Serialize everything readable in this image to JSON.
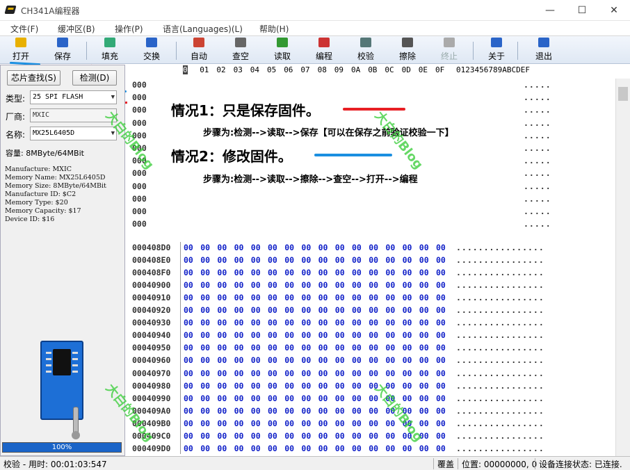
{
  "window": {
    "title": "CH341A编程器",
    "minimize": "—",
    "maximize": "☐",
    "close": "✕"
  },
  "menu": [
    "文件(F)",
    "缓冲区(B)",
    "操作(P)",
    "语言(Languages)(L)",
    "帮助(H)"
  ],
  "toolbar": [
    {
      "label": "打开",
      "icon": "folder-open-icon",
      "color": "#e8b000"
    },
    {
      "label": "保存",
      "icon": "save-disk-icon",
      "color": "#2a64c8"
    },
    {
      "label": "填充",
      "icon": "fill-icon",
      "color": "#3a7"
    },
    {
      "label": "交换",
      "icon": "swap-arrows-icon",
      "color": "#2a64c8"
    },
    {
      "label": "自动",
      "icon": "auto-chip-icon",
      "color": "#c43"
    },
    {
      "label": "查空",
      "icon": "blank-check-chip-icon",
      "color": "#666"
    },
    {
      "label": "读取",
      "icon": "read-chip-icon",
      "color": "#393"
    },
    {
      "label": "编程",
      "icon": "program-chip-icon",
      "color": "#c33"
    },
    {
      "label": "校验",
      "icon": "verify-icon",
      "color": "#577"
    },
    {
      "label": "擦除",
      "icon": "erase-chip-icon",
      "color": "#555"
    },
    {
      "label": "终止",
      "icon": "stop-icon",
      "color": "#aaa",
      "disabled": true
    },
    {
      "label": "关于",
      "icon": "info-icon",
      "color": "#2a64c8"
    },
    {
      "label": "退出",
      "icon": "exit-door-icon",
      "color": "#2a64c8"
    }
  ],
  "left_panel": {
    "search_button": "芯片查找(S)",
    "detect_button": "检测(D)",
    "type_label": "类型:",
    "type_value": "25 SPI FLASH",
    "vendor_label": "厂商:",
    "vendor_value": "MXIC",
    "name_label": "名称:",
    "name_value": "MX25L6405D",
    "capacity": "容量: 8MByte/64MBit",
    "chip_info": [
      "Manufacture: MXIC",
      "Memory Name: MX25L6405D",
      "Memory Size: 8MByte/64MBit",
      "Manufacture ID: $C2",
      "Memory Type: $20",
      "Memory Capacity: $17",
      "Device ID: $16"
    ],
    "progress": 1.0,
    "progress_text": "100%"
  },
  "hex_header": {
    "columns": [
      "0",
      "01",
      "02",
      "03",
      "04",
      "05",
      "06",
      "07",
      "08",
      "09",
      "0A",
      "0B",
      "0C",
      "0D",
      "0E",
      "0F"
    ],
    "ascii_header": "0123456789ABCDEF"
  },
  "hex_rows_top": [
    "000",
    "000",
    "000",
    "000",
    "000",
    "000",
    "000",
    "000",
    "000",
    "000",
    "000",
    "000"
  ],
  "hex_rows": [
    {
      "addr": "000408D0",
      "ascii": "................"
    },
    {
      "addr": "000408E0",
      "ascii": "................"
    },
    {
      "addr": "000408F0",
      "ascii": "................"
    },
    {
      "addr": "00040900",
      "ascii": "................"
    },
    {
      "addr": "00040910",
      "ascii": "................"
    },
    {
      "addr": "00040920",
      "ascii": "................"
    },
    {
      "addr": "00040930",
      "ascii": "................"
    },
    {
      "addr": "00040940",
      "ascii": "................"
    },
    {
      "addr": "00040950",
      "ascii": "................"
    },
    {
      "addr": "00040960",
      "ascii": "................"
    },
    {
      "addr": "00040970",
      "ascii": "................"
    },
    {
      "addr": "00040980",
      "ascii": "................"
    },
    {
      "addr": "00040990",
      "ascii": "................"
    },
    {
      "addr": "000409A0",
      "ascii": "................"
    },
    {
      "addr": "000409B0",
      "ascii": "................"
    },
    {
      "addr": "000409C0",
      "ascii": "................"
    },
    {
      "addr": "000409D0",
      "ascii": "................"
    }
  ],
  "byte_value": "00",
  "ascii_top_fragment": ".....",
  "overlay": {
    "case1_title": "情况1：只是保存固件。",
    "case1_steps": "步骤为:检测-->读取-->保存【可以在保存之前验证校验一下】",
    "case2_title": "情况2：修改固件。",
    "case2_steps": "步骤为:检测-->读取-->擦除-->查空-->打开-->编程"
  },
  "watermark": "大白的Blog",
  "status": {
    "left": "校验 - 用时: 00:01:03:547",
    "mode": "覆盖",
    "position": "位置: 00000000, 0",
    "connection": "设备连接状态: 已连接."
  },
  "annotation_colors": {
    "red": "#e81f24",
    "blue": "#1b8fe0"
  }
}
